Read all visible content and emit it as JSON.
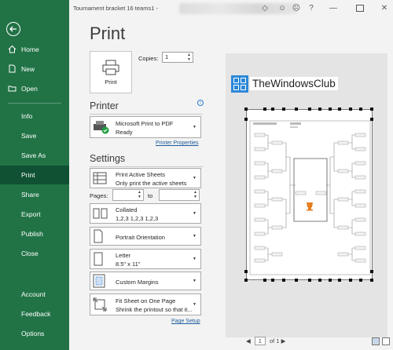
{
  "window": {
    "doc_title": "Tournament bracket 16 teams1  -",
    "minimize": "—",
    "close": "✕"
  },
  "nav": {
    "items": [
      {
        "label": "Home",
        "icon": "home-icon"
      },
      {
        "label": "New",
        "icon": "new-document-icon"
      },
      {
        "label": "Open",
        "icon": "open-folder-icon"
      },
      {
        "label": "Info"
      },
      {
        "label": "Save"
      },
      {
        "label": "Save As"
      },
      {
        "label": "Print",
        "active": true
      },
      {
        "label": "Share"
      },
      {
        "label": "Export"
      },
      {
        "label": "Publish"
      },
      {
        "label": "Close"
      },
      {
        "label": "Account"
      },
      {
        "label": "Feedback"
      },
      {
        "label": "Options"
      }
    ]
  },
  "print": {
    "title": "Print",
    "button_label": "Print",
    "copies_label": "Copies:",
    "copies_value": "1",
    "printer_heading": "Printer",
    "printer_name": "Microsoft Print to PDF",
    "printer_status": "Ready",
    "printer_properties": "Printer Properties",
    "settings_heading": "Settings",
    "pages_label": "Pages:",
    "to_label": "to",
    "page_setup": "Page Setup",
    "settings": [
      {
        "line1": "Print Active Sheets",
        "line2": "Only print the active sheets",
        "icon": "sheets-icon"
      },
      {
        "line1": "Collated",
        "line2": "1,2,3    1,2,3    1,2,3",
        "icon": "collated-icon"
      },
      {
        "line1": "Portrait Orientation",
        "line2": "",
        "icon": "portrait-icon"
      },
      {
        "line1": "Letter",
        "line2": "8.5\" x 11\"",
        "icon": "paper-size-icon"
      },
      {
        "line1": "Custom Margins",
        "line2": "",
        "icon": "margins-icon"
      },
      {
        "line1": "Fit Sheet on One Page",
        "line2": "Shrink the printout so that it...",
        "icon": "scaling-icon"
      }
    ]
  },
  "preview": {
    "watermark": "TheWindowsClub",
    "current_page": "1",
    "of_pages": "of 1"
  },
  "colors": {
    "nav_bg": "#217346",
    "nav_active": "#0f5132",
    "link": "#1e5c9c"
  }
}
